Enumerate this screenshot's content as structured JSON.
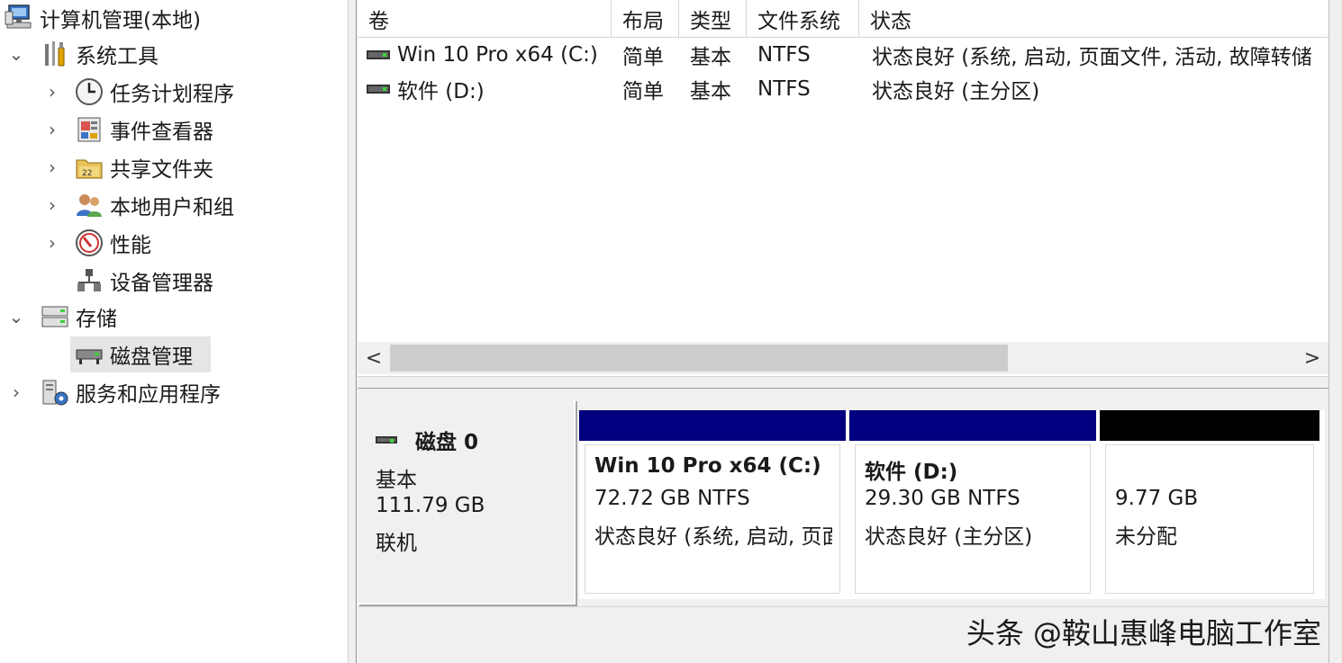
{
  "tree": {
    "root": "计算机管理(本地)",
    "system_tools": "系统工具",
    "task_scheduler": "任务计划程序",
    "event_viewer": "事件查看器",
    "shared_folders": "共享文件夹",
    "local_users": "本地用户和组",
    "performance": "性能",
    "device_manager": "设备管理器",
    "storage": "存储",
    "disk_management": "磁盘管理",
    "services_apps": "服务和应用程序"
  },
  "volume_list": {
    "columns": [
      "卷",
      "布局",
      "类型",
      "文件系统",
      "状态"
    ],
    "rows": [
      {
        "volume": "Win 10 Pro x64 (C:)",
        "layout": "简单",
        "type": "基本",
        "fs": "NTFS",
        "status": "状态良好 (系统, 启动, 页面文件, 活动, 故障转储"
      },
      {
        "volume": "软件 (D:)",
        "layout": "简单",
        "type": "基本",
        "fs": "NTFS",
        "status": "状态良好 (主分区)"
      }
    ],
    "scroll_left": "<",
    "scroll_right": ">"
  },
  "disk": {
    "name": "磁盘 0",
    "type": "基本",
    "size": "111.79 GB",
    "state": "联机",
    "partitions": [
      {
        "title": "Win 10 Pro x64  (C:)",
        "size": "72.72 GB NTFS",
        "status": "状态良好 (系统, 启动, 页面文件, 活动, 故障转储, 主分区)",
        "color": "#000080"
      },
      {
        "title": "软件  (D:)",
        "size": "29.30 GB NTFS",
        "status": "状态良好 (主分区)",
        "color": "#000080"
      },
      {
        "title": "",
        "size": "9.77 GB",
        "status": "未分配",
        "color": "#000000"
      }
    ]
  },
  "watermark": "头条 @鞍山惠峰电脑工作室"
}
